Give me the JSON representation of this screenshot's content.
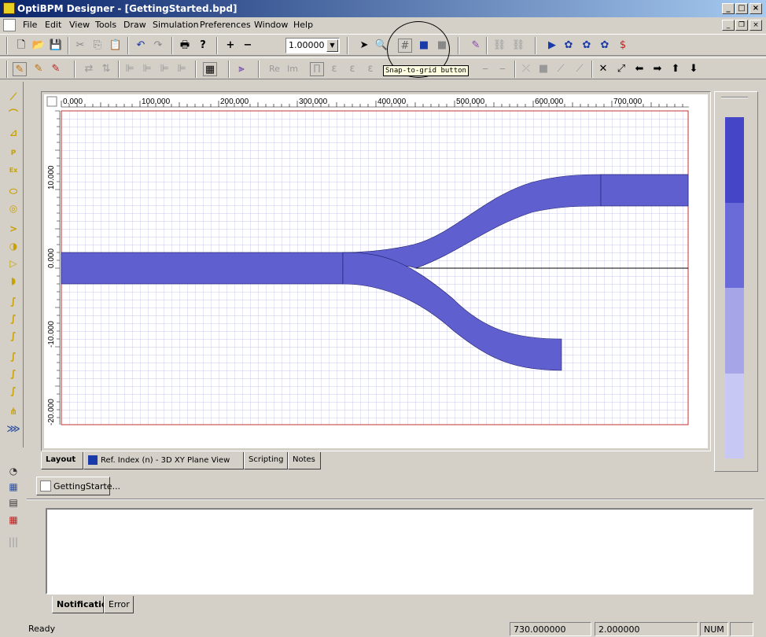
{
  "window": {
    "title": "OptiBPM Designer - [GettingStarted.bpd]"
  },
  "menu": [
    "File",
    "Edit",
    "View",
    "Tools",
    "Draw",
    "Simulation",
    "Preferences",
    "Window",
    "Help"
  ],
  "toolbar": {
    "zoom_value": "1.00000"
  },
  "tooltip": "Snap-to-grid button",
  "ruler_x": [
    "0.000",
    "100.000",
    "200.000",
    "300.000",
    "400.000",
    "500.000",
    "600.000",
    "700.000"
  ],
  "ruler_y": [
    "10.000",
    "0.000",
    "-10.000",
    "-20.000"
  ],
  "view_tabs": [
    "Layout",
    "Ref. Index (n) - 3D XY Plane View",
    "Scripting",
    "Notes"
  ],
  "doc_tab": "GettingStarte...",
  "notif_tabs": [
    "Notification",
    "Error"
  ],
  "status": {
    "text": "Ready",
    "x": "730.000000",
    "y": "2.000000",
    "num": "NUM"
  },
  "colors": {
    "waveguide": "#5f5fcf",
    "grid": "#b8b8e8",
    "boundary": "#c03030",
    "titlebar": "#0a246a"
  },
  "palette": [
    "#4545c8",
    "#6a6ad8",
    "#a5a5e8",
    "#c8c8f5"
  ]
}
